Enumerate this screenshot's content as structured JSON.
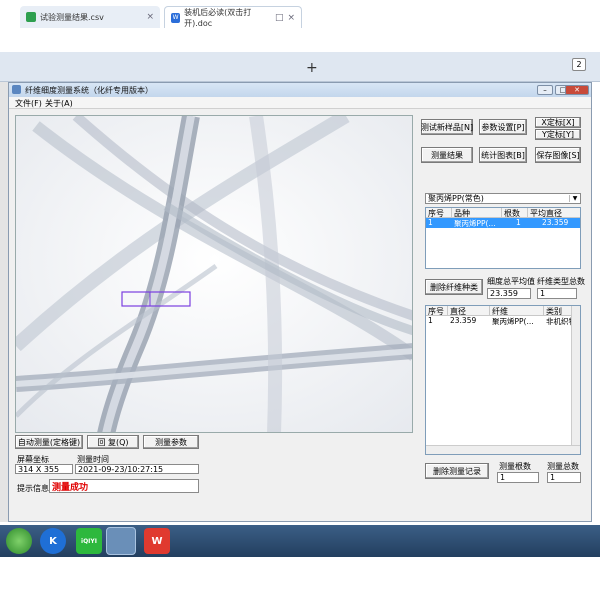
{
  "browser": {
    "tabs": [
      {
        "label": "试验测量结果.csv"
      },
      {
        "label": "装机后必读(双击打开).doc"
      }
    ],
    "new_tab": "+",
    "corner_badge": "2",
    "close_glyph": "×",
    "reading_glyph": "□"
  },
  "window": {
    "title": "纤维细度测量系统（化纤专用版本）",
    "menu": [
      "文件(F)",
      "关于(A)"
    ],
    "min_glyph": "–",
    "max_glyph": "□",
    "close_glyph": "✕"
  },
  "toolbar_right": {
    "measure_new": "测试新样品[N]",
    "params": "参数设置[P]",
    "x_calib": "X定标[X]",
    "y_calib": "Y定标[Y]",
    "results": "测量结果",
    "stats": "统计图表[B]",
    "save_image": "保存图像[S]"
  },
  "variety_select": {
    "value": "聚丙烯PP(常色)",
    "arrow": "▼"
  },
  "variety_table": {
    "headers": [
      "序号",
      "品种",
      "根数",
      "平均直径"
    ],
    "rows": [
      [
        "1",
        "聚丙烯PP(...",
        "1",
        "23.359"
      ]
    ]
  },
  "delete_variety": "删除纤维种类",
  "fineness_avg": {
    "label": "细度总平均值",
    "value": "23.359"
  },
  "type_total": {
    "label": "纤维类型总数",
    "value": "1"
  },
  "detail_table": {
    "headers": [
      "序号",
      "直径",
      "纤维",
      "类别"
    ],
    "rows": [
      [
        "1",
        "23.359",
        "聚丙烯PP(...",
        "非机织物"
      ]
    ]
  },
  "delete_record": "删除测量记录",
  "measure_count": {
    "label": "测量根数",
    "value": "1"
  },
  "measure_total": {
    "label": "测量总数",
    "value": "1"
  },
  "bottom_left": {
    "auto_measure": "自动测量(定格键)",
    "restore": "回  复(Q)",
    "measure_params": "测量参数",
    "screen_coord_label": "屏幕坐标",
    "screen_coord_value": "314 X 355",
    "measure_time_label": "测量时间",
    "measure_time_value": "2021-09-23/10:27:15",
    "hint_label": "提示信息",
    "hint_value": "测量成功"
  },
  "colors": {
    "hint_text": "#e00000",
    "selection": "#3399ff",
    "measure_box": "#7b3fe0"
  },
  "taskbar": {
    "icons": [
      "start-orb-icon",
      "k-app-icon",
      "iqiyi-icon",
      "measure-app-icon",
      "wps-icon"
    ],
    "k_label": "K",
    "iqiyi_label": "iQIYI",
    "wps_label": "W"
  }
}
